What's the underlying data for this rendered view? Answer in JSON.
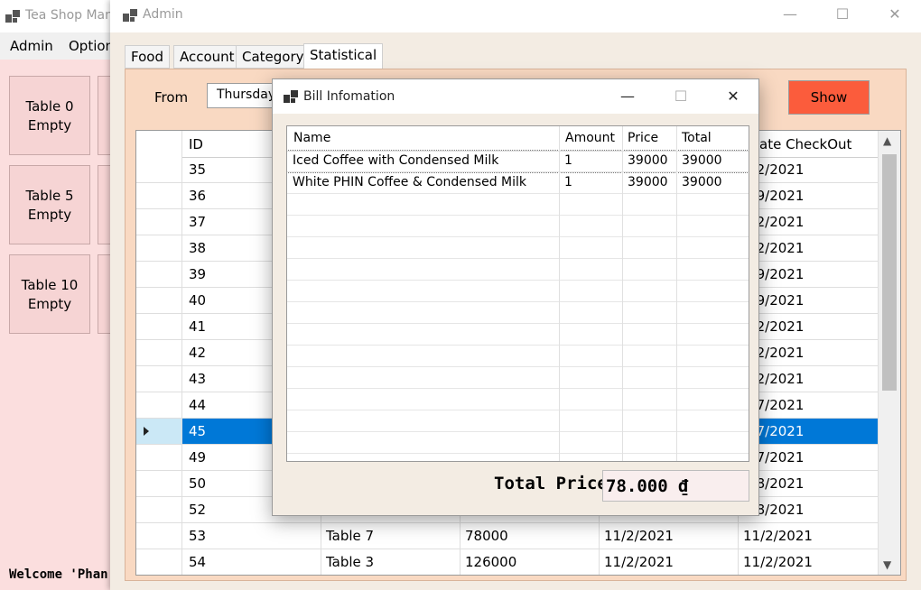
{
  "main_window": {
    "title": "Tea Shop Man",
    "menu": [
      "Admin",
      "Option"
    ],
    "tables": [
      {
        "name": "Table 0",
        "status": "Empty"
      },
      {
        "name": "Table 5",
        "status": "Empty"
      },
      {
        "name": "Table 10",
        "status": "Empty"
      }
    ],
    "welcome": "Welcome 'Phan"
  },
  "admin_window": {
    "title": "Admin",
    "controls": {
      "minimize": "—",
      "maximize": "☐",
      "close": "✕"
    },
    "tabs": [
      "Food",
      "Account",
      "Category",
      "Statistical"
    ],
    "active_tab": "Statistical",
    "filter": {
      "from_label": "From",
      "from_value": "Thursday",
      "show_label": "Show"
    },
    "grid": {
      "columns": [
        "ID",
        "ate CheckOut"
      ],
      "rows": [
        {
          "id": "35",
          "table": "",
          "total": "",
          "checkin": "",
          "checkout": "/22/2021"
        },
        {
          "id": "36",
          "table": "",
          "total": "",
          "checkin": "",
          "checkout": "/19/2021"
        },
        {
          "id": "37",
          "table": "",
          "total": "",
          "checkin": "",
          "checkout": "/22/2021"
        },
        {
          "id": "38",
          "table": "",
          "total": "",
          "checkin": "",
          "checkout": "/22/2021"
        },
        {
          "id": "39",
          "table": "",
          "total": "",
          "checkin": "",
          "checkout": "/19/2021"
        },
        {
          "id": "40",
          "table": "",
          "total": "",
          "checkin": "",
          "checkout": "/19/2021"
        },
        {
          "id": "41",
          "table": "",
          "total": "",
          "checkin": "",
          "checkout": "/22/2021"
        },
        {
          "id": "42",
          "table": "",
          "total": "",
          "checkin": "",
          "checkout": "/22/2021"
        },
        {
          "id": "43",
          "table": "",
          "total": "",
          "checkin": "",
          "checkout": "/22/2021"
        },
        {
          "id": "44",
          "table": "",
          "total": "",
          "checkin": "",
          "checkout": "/27/2021"
        },
        {
          "id": "45",
          "table": "",
          "total": "",
          "checkin": "",
          "checkout": "/27/2021"
        },
        {
          "id": "49",
          "table": "",
          "total": "",
          "checkin": "",
          "checkout": "/27/2021"
        },
        {
          "id": "50",
          "table": "",
          "total": "",
          "checkin": "",
          "checkout": "/28/2021"
        },
        {
          "id": "52",
          "table": "",
          "total": "",
          "checkin": "",
          "checkout": "/28/2021"
        },
        {
          "id": "53",
          "table": "Table 7",
          "total": "78000",
          "checkin": "11/2/2021",
          "checkout": "11/2/2021"
        },
        {
          "id": "54",
          "table": "Table 3",
          "total": "126000",
          "checkin": "11/2/2021",
          "checkout": "11/2/2021"
        }
      ],
      "selected_row": 10
    }
  },
  "bill_dialog": {
    "title": "Bill Infomation",
    "controls": {
      "minimize": "—",
      "maximize": "☐",
      "close": "✕"
    },
    "columns": [
      "Name",
      "Amount",
      "Price",
      "Total"
    ],
    "items": [
      {
        "name": "Iced Coffee with Condensed Milk",
        "amount": "1",
        "price": "39000",
        "total": "39000"
      },
      {
        "name": "White PHIN Coffee & Condensed Milk",
        "amount": "1",
        "price": "39000",
        "total": "39000"
      }
    ],
    "total_label": "Total Price",
    "total_value": "78.000 ₫"
  },
  "colors": {
    "selection": "#0078d7",
    "show_button": "#fb5c3c",
    "tab_page": "#f9d9c2"
  }
}
